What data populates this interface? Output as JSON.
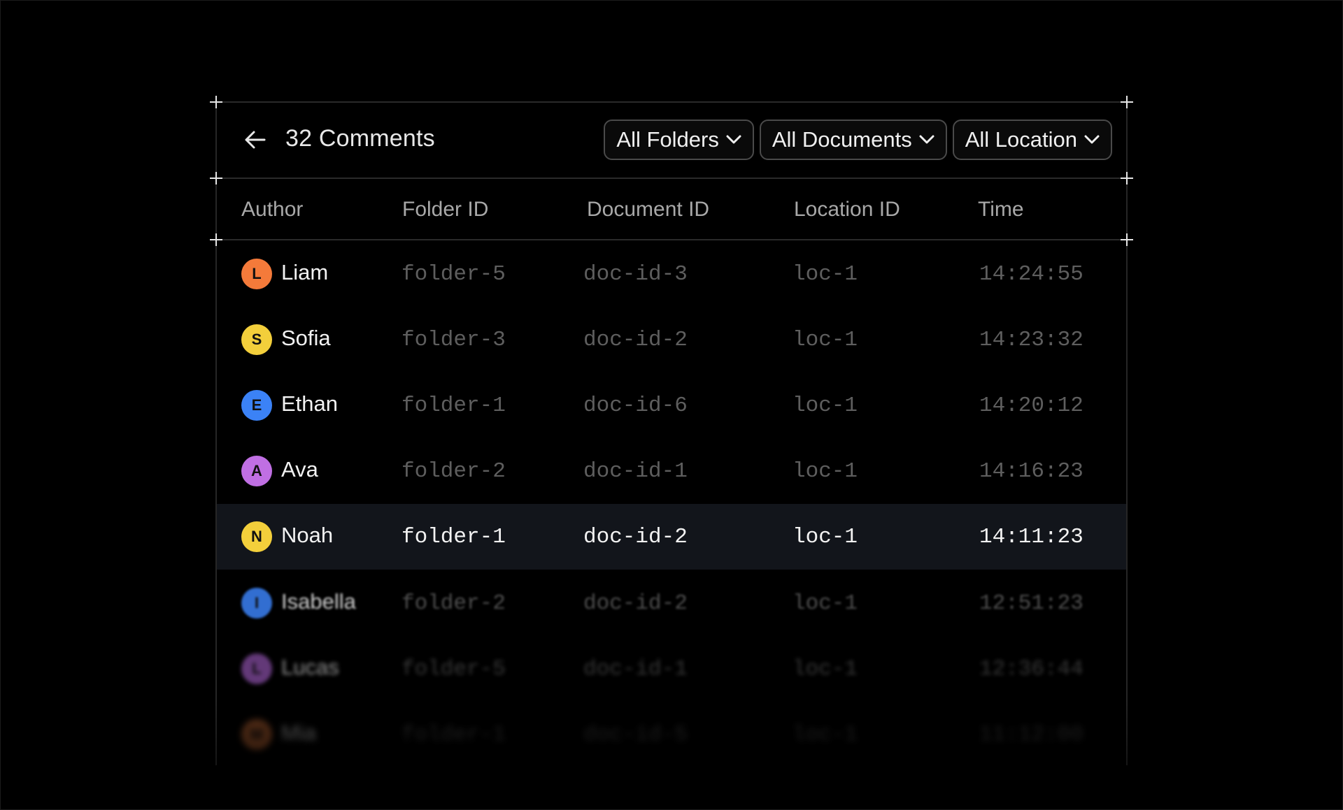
{
  "header": {
    "title": "32 Comments",
    "back_icon": "arrow-left-icon",
    "filters": [
      {
        "label": "All Folders",
        "icon": "chevron-down-icon"
      },
      {
        "label": "All Documents",
        "icon": "chevron-down-icon"
      },
      {
        "label": "All Location",
        "icon": "chevron-down-icon"
      }
    ]
  },
  "columns": {
    "author": "Author",
    "folder": "Folder ID",
    "document": "Document ID",
    "location": "Location ID",
    "time": "Time"
  },
  "rows": [
    {
      "initial": "L",
      "author": "Liam",
      "folder": "folder-5",
      "document": "doc-id-3",
      "location": "loc-1",
      "time": "14:24:55",
      "color": "#f47a3a"
    },
    {
      "initial": "S",
      "author": "Sofia",
      "folder": "folder-3",
      "document": "doc-id-2",
      "location": "loc-1",
      "time": "14:23:32",
      "color": "#f3cf3b"
    },
    {
      "initial": "E",
      "author": "Ethan",
      "folder": "folder-1",
      "document": "doc-id-6",
      "location": "loc-1",
      "time": "14:20:12",
      "color": "#3b82f6"
    },
    {
      "initial": "A",
      "author": "Ava",
      "folder": "folder-2",
      "document": "doc-id-1",
      "location": "loc-1",
      "time": "14:16:23",
      "color": "#c06fe3"
    },
    {
      "initial": "N",
      "author": "Noah",
      "folder": "folder-1",
      "document": "doc-id-2",
      "location": "loc-1",
      "time": "14:11:23",
      "color": "#f3cf3b"
    },
    {
      "initial": "I",
      "author": "Isabella",
      "folder": "folder-2",
      "document": "doc-id-2",
      "location": "loc-1",
      "time": "12:51:23",
      "color": "#3b82f6"
    },
    {
      "initial": "L",
      "author": "Lucas",
      "folder": "folder-5",
      "document": "doc-id-1",
      "location": "loc-1",
      "time": "12:36:44",
      "color": "#a55fc9"
    },
    {
      "initial": "M",
      "author": "Mia",
      "folder": "folder-1",
      "document": "doc-id-5",
      "location": "loc-1",
      "time": "11:12:00",
      "color": "#d9743a"
    }
  ],
  "colors": {
    "background": "#000000",
    "highlight_row": "#12151b",
    "muted_text": "#5e5e5e"
  }
}
